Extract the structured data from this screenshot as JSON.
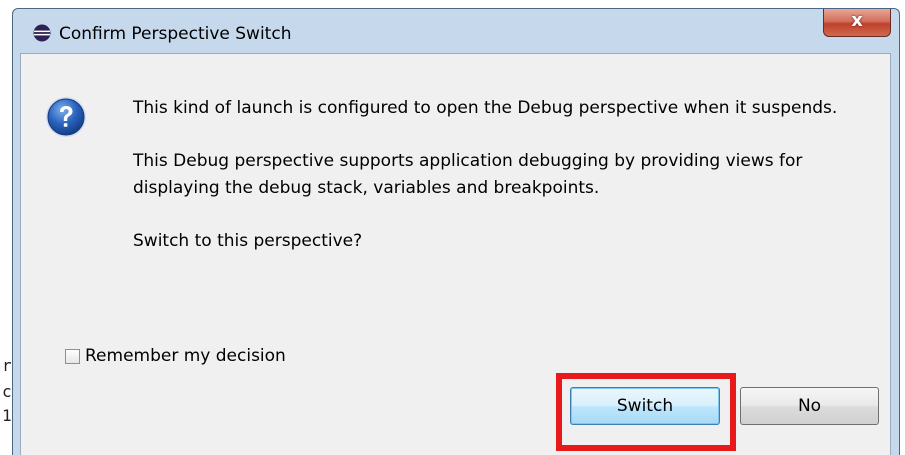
{
  "window": {
    "title": "Confirm Perspective Switch",
    "close_glyph": "x"
  },
  "message": {
    "icon": "question-icon",
    "line1": "This kind of launch is configured to open the Debug perspective when it suspends.",
    "line2": "This Debug perspective supports application debugging by providing views for displaying the debug stack, variables and breakpoints.",
    "line3": "Switch to this perspective?"
  },
  "remember": {
    "label": "Remember my decision",
    "checked": false
  },
  "buttons": {
    "switch_label": "Switch",
    "no_label": "No"
  },
  "background_chars": [
    "r",
    "c",
    "1"
  ],
  "colors": {
    "highlight": "#e8191b",
    "frame": "#c6d8ec",
    "client": "#f0f0f0",
    "close": "#c0402c"
  }
}
